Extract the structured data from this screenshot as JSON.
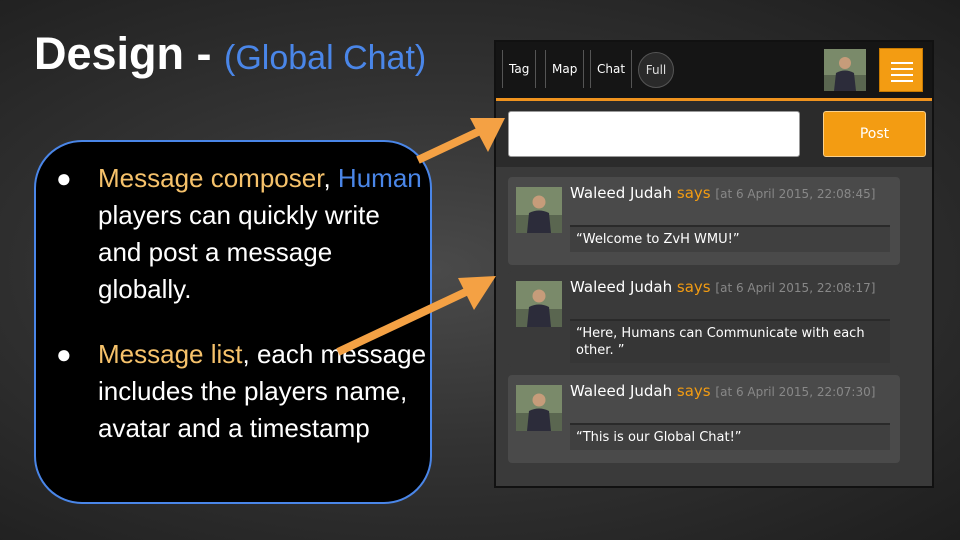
{
  "slide": {
    "title_main": "Design - ",
    "title_sub": "(Global Chat)"
  },
  "callout": {
    "item1": {
      "highlight": "Message composer",
      "sep": ",",
      "human": "Human",
      "rest": " players can quickly write and post a message globally."
    },
    "item2": {
      "highlight": "Message list",
      "rest": ", each message includes the players name, avatar and a timestamp"
    }
  },
  "app": {
    "tabs": [
      "Tag",
      "Map",
      "Chat"
    ],
    "full_label": "Full",
    "post_label": "Post",
    "composer_value": "",
    "messages": [
      {
        "author": "Waleed Judah",
        "says": "says",
        "timestamp": "[at 6 April 2015, 22:08:45]",
        "text": "“Welcome to ZvH WMU!”"
      },
      {
        "author": "Waleed Judah",
        "says": "says",
        "timestamp": "[at 6 April 2015, 22:08:17]",
        "text": "“Here, Humans can Communicate with each other. ”"
      },
      {
        "author": "Waleed Judah",
        "says": "says",
        "timestamp": "[at 6 April 2015, 22:07:30]",
        "text": "“This is our Global Chat!”"
      }
    ]
  },
  "colors": {
    "accent": "#f39c12",
    "blue": "#4a86e8",
    "yellow": "#f6c26b"
  }
}
